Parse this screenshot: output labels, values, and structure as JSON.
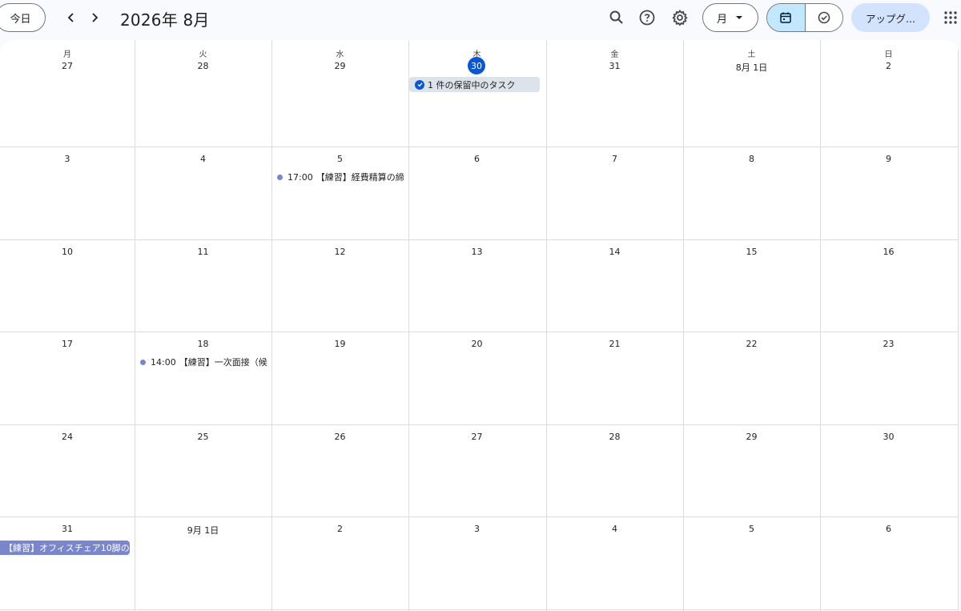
{
  "toolbar": {
    "today_label": "今日",
    "title": "2026年 8月",
    "view_label": "月",
    "upgrade_label": "アップグ..."
  },
  "weekdays": [
    "月",
    "火",
    "水",
    "木",
    "金",
    "土",
    "日"
  ],
  "weeks": [
    [
      "27",
      "28",
      "29",
      "30",
      "31",
      "8月 1日",
      "2"
    ],
    [
      "3",
      "4",
      "5",
      "6",
      "7",
      "8",
      "9"
    ],
    [
      "10",
      "11",
      "12",
      "13",
      "14",
      "15",
      "16"
    ],
    [
      "17",
      "18",
      "19",
      "20",
      "21",
      "22",
      "23"
    ],
    [
      "24",
      "25",
      "26",
      "27",
      "28",
      "29",
      "30"
    ],
    [
      "31",
      "9月 1日",
      "2",
      "3",
      "4",
      "5",
      "6"
    ]
  ],
  "events": {
    "task": {
      "label": "1 件の保留中のタスク"
    },
    "event1": {
      "time": "17:00",
      "title": "【練習】経費精算の締"
    },
    "event2": {
      "time": "14:00",
      "title": "【練習】一次面接（候"
    },
    "allday": {
      "title": "【練習】オフィスチェア10脚の"
    }
  },
  "colors": {
    "accent": "#0b57d0",
    "event": "#7986cb",
    "toggle_active": "#c2e7ff",
    "upgrade_bg": "#d3e3fd"
  }
}
